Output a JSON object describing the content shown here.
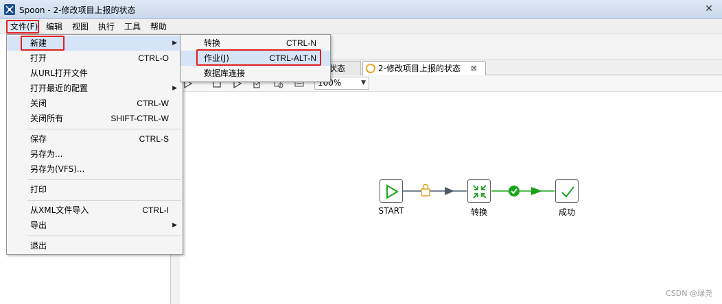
{
  "window": {
    "title": "Spoon - 2-修改项目上报的状态",
    "close_glyph": "✕"
  },
  "menubar": {
    "items": [
      {
        "label": "文件(F)"
      },
      {
        "label": "编辑"
      },
      {
        "label": "视图"
      },
      {
        "label": "执行"
      },
      {
        "label": "工具"
      },
      {
        "label": "帮助"
      }
    ]
  },
  "file_menu": {
    "items": [
      {
        "label": "新建",
        "shortcut": "",
        "submenu": true
      },
      {
        "label": "打开",
        "shortcut": "CTRL-O"
      },
      {
        "label": "从URL打开文件",
        "shortcut": ""
      },
      {
        "label": "打开最近的配置",
        "shortcut": "",
        "submenu": true
      },
      {
        "label": "关闭",
        "shortcut": "CTRL-W"
      },
      {
        "label": "关闭所有",
        "shortcut": "SHIFT-CTRL-W"
      },
      {
        "label": "保存",
        "shortcut": "CTRL-S"
      },
      {
        "label": "另存为...",
        "shortcut": ""
      },
      {
        "label": "另存为(VFS)...",
        "shortcut": ""
      },
      {
        "label": "打印",
        "shortcut": ""
      },
      {
        "label": "从XML文件导入",
        "shortcut": "CTRL-I"
      },
      {
        "label": "导出",
        "shortcut": "",
        "submenu": true
      },
      {
        "label": "退出",
        "shortcut": ""
      }
    ]
  },
  "new_submenu": {
    "items": [
      {
        "label": "转换",
        "shortcut": "CTRL-N"
      },
      {
        "label": "作业(J)",
        "shortcut": "CTRL-ALT-N"
      },
      {
        "label": "数据库连接",
        "shortcut": ""
      }
    ]
  },
  "tabs": {
    "previous": "状态",
    "current": "2-修改项目上报的状态",
    "close_glyph": "⊠"
  },
  "toolbar": {
    "zoom": "100%"
  },
  "job": {
    "entries": [
      {
        "name": "START",
        "icon": "play-triangle-icon"
      },
      {
        "name": "转换",
        "icon": "transformation-icon"
      },
      {
        "name": "成功",
        "icon": "checkmark-icon"
      }
    ],
    "hops": [
      {
        "from": "START",
        "to": "转换",
        "icon": "lock-icon"
      },
      {
        "from": "转换",
        "to": "成功",
        "icon": "success-check-icon"
      }
    ]
  },
  "watermark": "CSDN @琭尧",
  "colors": {
    "highlight_box": "#e02020",
    "menu_hover": "#d5e4f7",
    "entry_green": "#1aa31a",
    "hop_dark": "#4a5a6a",
    "lock_orange": "#e0a020"
  }
}
